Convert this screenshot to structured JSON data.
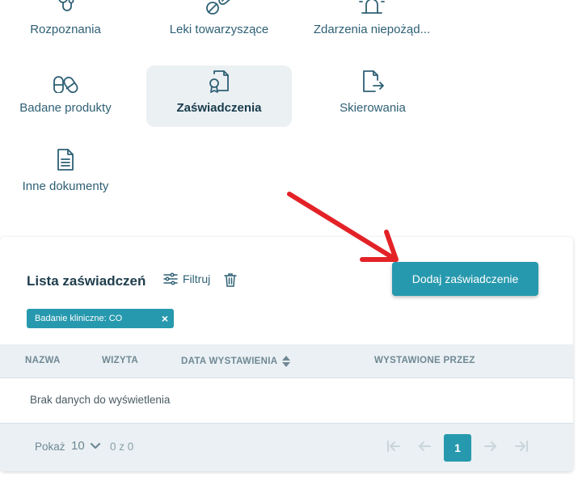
{
  "tiles": [
    {
      "label": "Rozpoznania",
      "icon": "stethoscope-icon",
      "active": false
    },
    {
      "label": "Leki towarzyszące",
      "icon": "pill-icon",
      "active": false
    },
    {
      "label": "Zdarzenia niepożąd...",
      "icon": "siren-icon",
      "active": false
    },
    {
      "label": "Badane produkty",
      "icon": "capsules-icon",
      "active": false
    },
    {
      "label": "Zaświadczenia",
      "icon": "certificate-icon",
      "active": true
    },
    {
      "label": "Skierowania",
      "icon": "referral-icon",
      "active": false
    },
    {
      "label": "Inne dokumenty",
      "icon": "document-icon",
      "active": false
    }
  ],
  "list": {
    "title": "Lista zaświadczeń",
    "filter_label": "Filtruj",
    "add_button": "Dodaj zaświadczenie",
    "chip": {
      "text": "Badanie kliniczne: CO",
      "remove": "×"
    },
    "columns": [
      "NAZWA",
      "WIZYTA",
      "DATA WYSTAWIENIA",
      "WYSTAWIONE PRZEZ"
    ],
    "empty_text": "Brak danych do wyświetlenia"
  },
  "pagination": {
    "show_label": "Pokaż",
    "per_page": "10",
    "range": "0 z 0",
    "current_page": "1"
  },
  "colors": {
    "accent": "#2799ae",
    "annotation_arrow": "#e32227",
    "active_tile_bg": "#ebf0f3"
  }
}
